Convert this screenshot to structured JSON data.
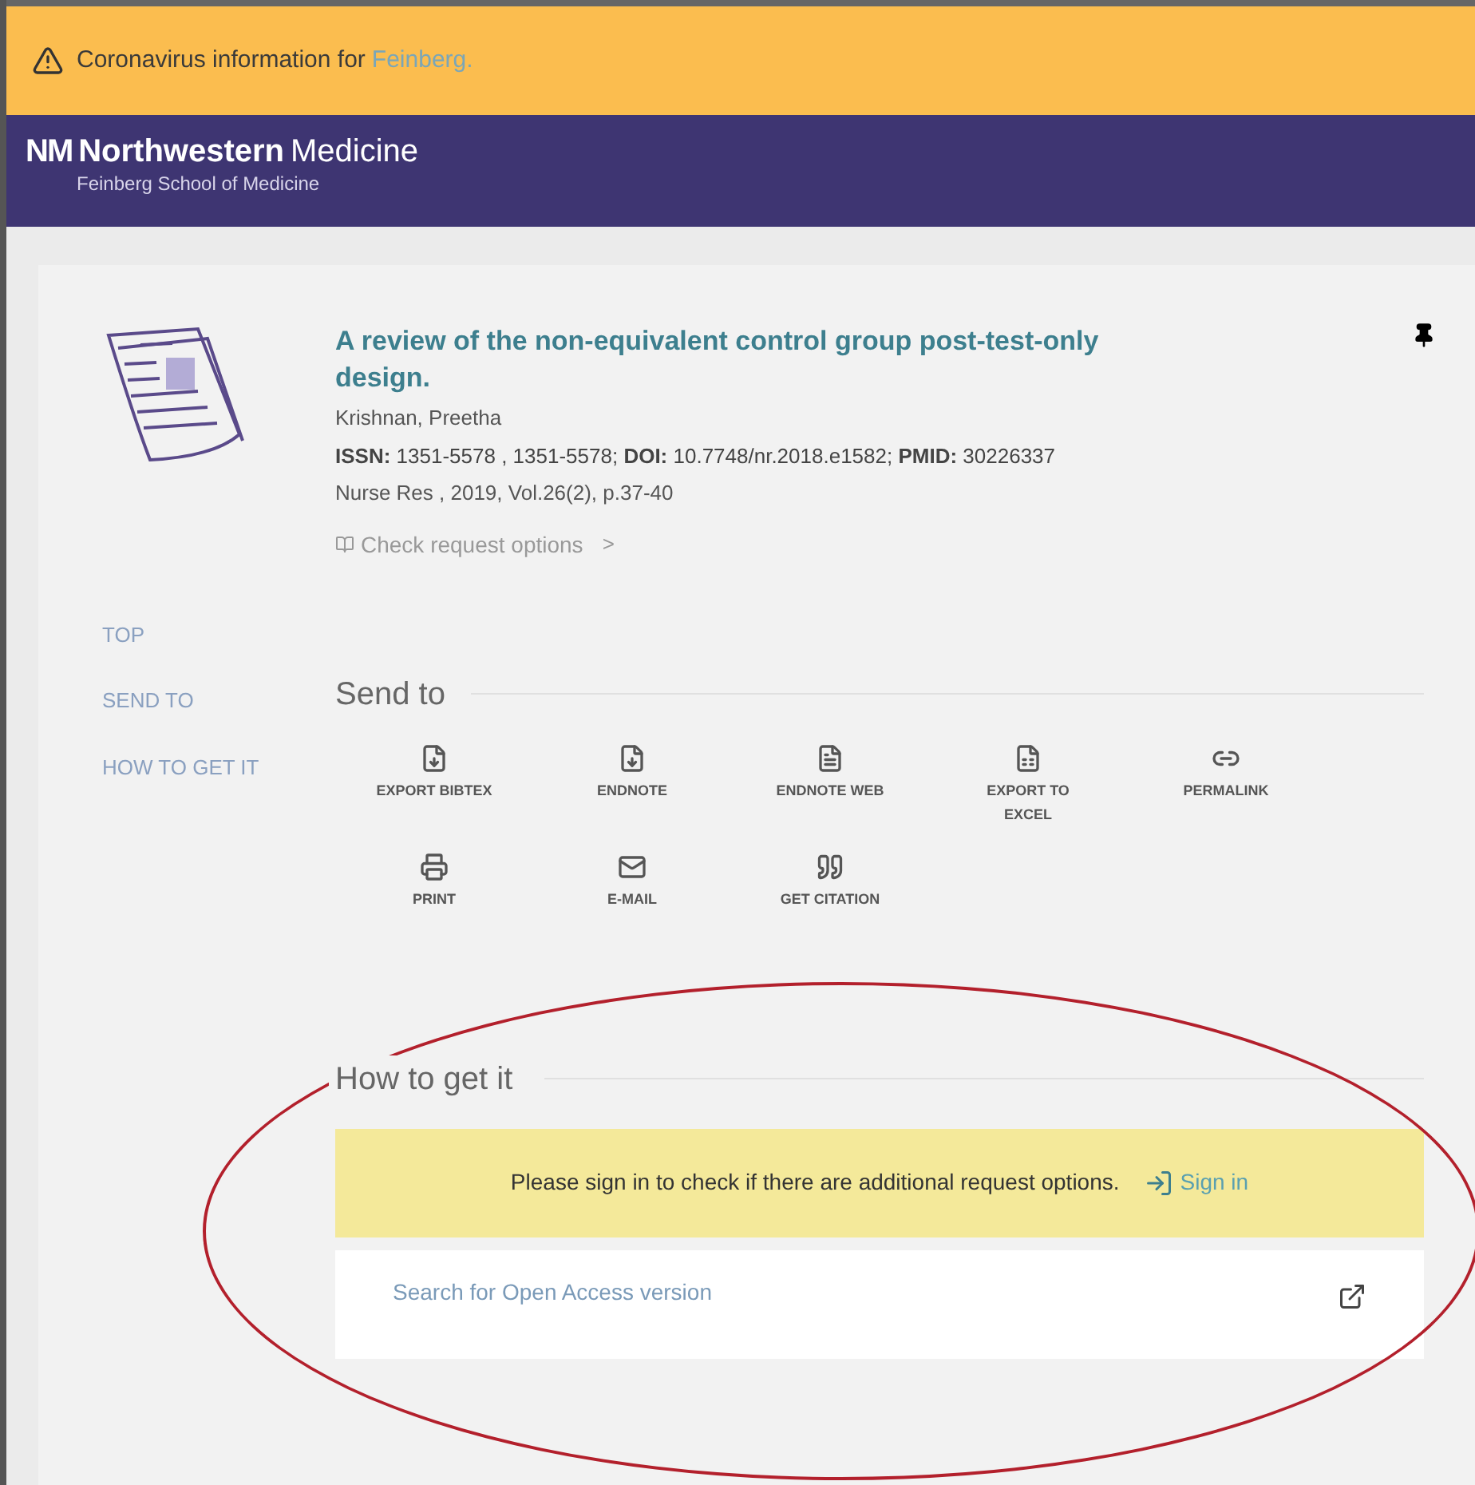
{
  "banner": {
    "text": "Coronavirus information for",
    "link": "Feinberg."
  },
  "header": {
    "logo_mark": "NM",
    "brand_bold": "Northwestern",
    "brand_light": "Medicine",
    "subtitle": "Feinberg School of Medicine"
  },
  "record": {
    "title": "A review of the non-equivalent control group post-test-only design.",
    "author": "Krishnan, Preetha",
    "identifiers": "**ISSN:** 1351-5578 , 1351-5578; **DOI:** 10.7748/nr.2018.e1582; **PMID:** 30226337",
    "source": "Nurse Res , 2019, Vol.26(2), p.37-40",
    "availability": "Check request options",
    "availability_arrow": ">"
  },
  "side_nav": [
    "TOP",
    "SEND TO",
    "HOW TO GET IT"
  ],
  "send_to": {
    "heading": "Send to",
    "items": [
      {
        "label": "EXPORT BIBTEX"
      },
      {
        "label": "ENDNOTE"
      },
      {
        "label": "ENDNOTE WEB"
      },
      {
        "label": "EXPORT TO EXCEL"
      },
      {
        "label": "PERMALINK"
      },
      {
        "label": "PRINT"
      },
      {
        "label": "E-MAIL"
      },
      {
        "label": "GET CITATION"
      }
    ]
  },
  "how_to_get_it": {
    "heading": "How to get it",
    "notice": "Please sign in to check if there are additional request options.",
    "sign_in": "Sign in",
    "open_access": "Search for Open Access version"
  }
}
